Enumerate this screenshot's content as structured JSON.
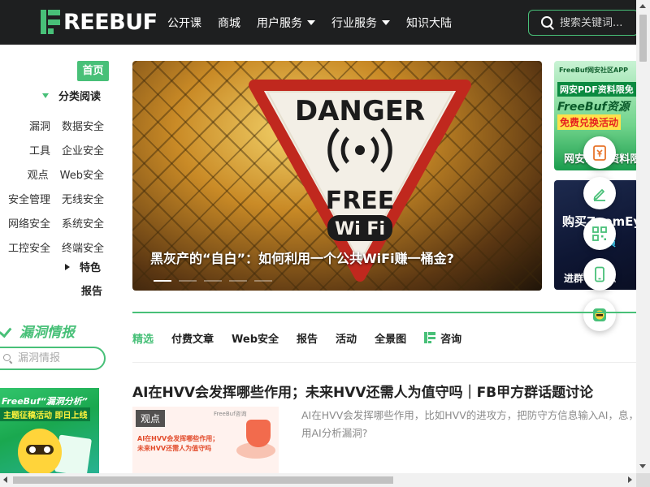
{
  "header": {
    "logo_text": "REEBUF",
    "nav": [
      {
        "label": "公开课",
        "dropdown": false
      },
      {
        "label": "商城",
        "dropdown": false
      },
      {
        "label": "用户服务",
        "dropdown": true
      },
      {
        "label": "行业服务",
        "dropdown": true
      },
      {
        "label": "知识大陆",
        "dropdown": false
      }
    ],
    "search_placeholder": "搜索关键词..."
  },
  "sidebar": {
    "home": "首页",
    "category_header": "分类阅读",
    "categories": [
      [
        "漏洞",
        "数据安全"
      ],
      [
        "工具",
        "企业安全"
      ],
      [
        "观点",
        "Web安全"
      ],
      [
        "安全管理",
        "无线安全"
      ],
      [
        "网络安全",
        "系统安全"
      ],
      [
        "工控安全",
        "终端安全"
      ]
    ],
    "featured": "特色",
    "report": "报告",
    "vuln_title": "漏洞情报",
    "vuln_search_placeholder": "漏洞情报",
    "promo": {
      "line1": "FreeBuf“漏洞分析”",
      "line2": "主题征稿活动 即日上线"
    }
  },
  "banner": {
    "sign_top": "DANGER",
    "sign_mid": "FREE",
    "sign_wifi": "Wi Fi",
    "title": "黑灰产的“自白”：如何利用一个公共WiFi赚一桶金?",
    "slide_count": 5,
    "active_slide": 1
  },
  "side_ads": {
    "ad1": {
      "line1": "FreeBuf网安社区APP",
      "line2": "网安PDF资料限免",
      "line3": "FreeBuf资源",
      "line4": "免费兑换活动",
      "caption": "网安PDF资料限"
    },
    "ad2": {
      "line1": "购买ZoomEye",
      "line2": "防演",
      "caption": "进群      防演练"
    }
  },
  "float_tools": [
    "coupon-icon",
    "edit-icon",
    "qrcode-icon",
    "mobile-icon",
    "mascot-icon"
  ],
  "tabs": [
    "精选",
    "付费文章",
    "Web安全",
    "报告",
    "活动",
    "全景图",
    "咨询"
  ],
  "active_tab": "精选",
  "article": {
    "title": "AI在HVV会发挥哪些作用；未来HVV还需人为值守吗｜FB甲方群话题讨论",
    "tag": "观点",
    "thumb_line1": "AI在HVV会发挥哪些作用；",
    "thumb_line2": "未来HVV还需人为值守吗",
    "thumb_brand": "FreeBuf咨询",
    "description": "AI在HVV会发挥哪些作用，比如HVV的进攻方，把防守方信息输入AI，息，用AI分析漏洞?"
  },
  "colors": {
    "accent": "#48c078",
    "topbar": "#1e1f20",
    "danger_red": "#c0281e"
  }
}
